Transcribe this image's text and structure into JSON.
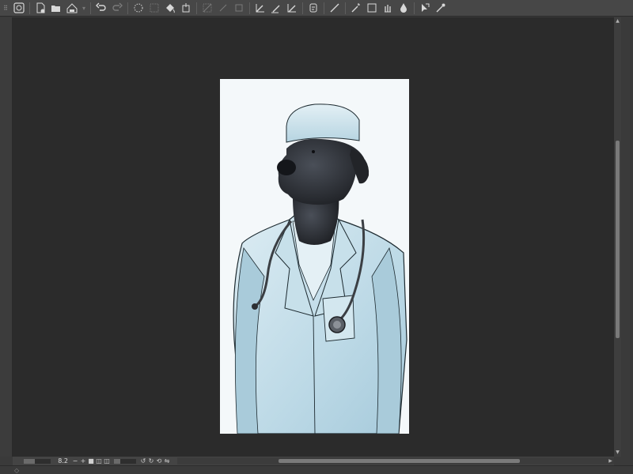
{
  "toolbar": {
    "items": [
      {
        "icon": "app-icon"
      },
      {
        "icon": "new-file-icon"
      },
      {
        "icon": "open-folder-icon"
      },
      {
        "icon": "save-icon"
      },
      {
        "icon": "undo-icon"
      },
      {
        "icon": "redo-icon"
      },
      {
        "icon": "loading-icon"
      },
      {
        "icon": "fill-icon"
      },
      {
        "icon": "transform-icon"
      },
      {
        "icon": "pen-icon"
      },
      {
        "icon": "brush-icon"
      },
      {
        "icon": "eraser-icon"
      },
      {
        "icon": "ruler-icon"
      },
      {
        "icon": "magic-wand-icon"
      },
      {
        "icon": "selection-icon"
      },
      {
        "icon": "eyedropper-icon"
      }
    ]
  },
  "bottombar": {
    "zoom_value": "8.2",
    "zoom_out_label": "−",
    "zoom_in_label": "+",
    "zoom_fraction": 0.42,
    "rotation_fraction": 0.3
  },
  "canvas": {
    "artwork": "dog-in-doctor-coat",
    "background": "#2b2b2b",
    "paper_color": "#f4f8fa"
  },
  "colors": {
    "toolbar_bg": "#474747",
    "coat": "#cfe6ef",
    "coat_shadow": "#9fc6d6",
    "dog": "#2a2d33"
  }
}
